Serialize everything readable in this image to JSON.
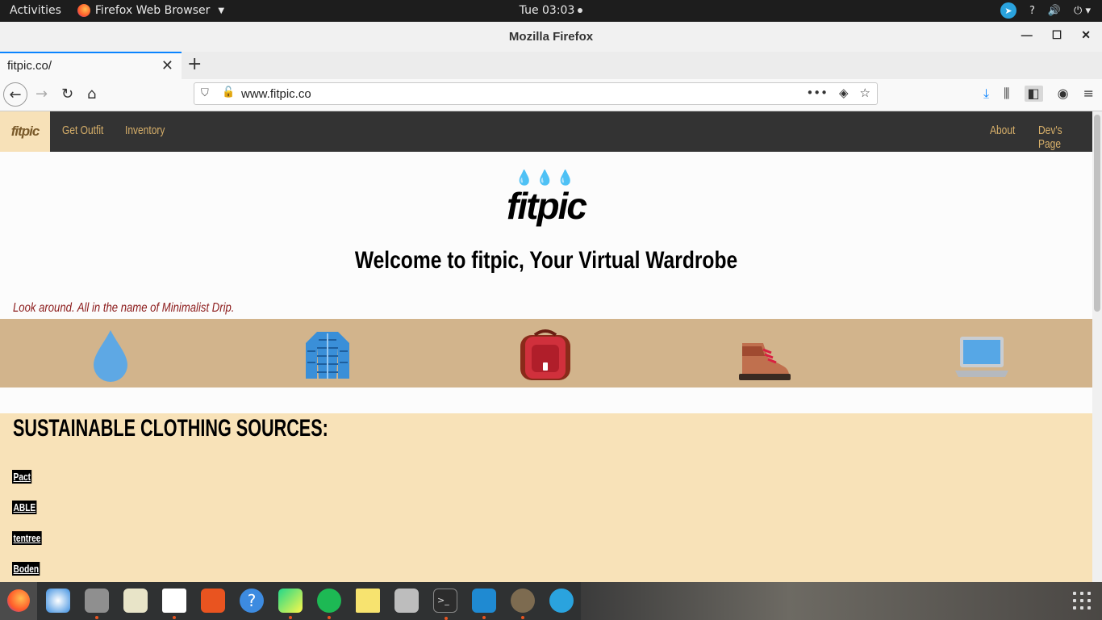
{
  "system": {
    "activities": "Activities",
    "app_name": "Firefox Web Browser",
    "clock": "Tue 03:03"
  },
  "window": {
    "title": "Mozilla Firefox"
  },
  "browser": {
    "tab_title": "fitpic.co/",
    "url": "www.fitpic.co"
  },
  "site": {
    "brand": "fitpic",
    "nav_left": [
      "Get Outfit",
      "Inventory"
    ],
    "nav_right": [
      "About",
      "Dev's Page"
    ],
    "logo_text": "fitpic",
    "welcome": "Welcome to fitpic, Your Virtual Wardrobe",
    "tagline": "Look around. All in the name of Minimalist Drip.",
    "strip_icons": [
      "droplet-icon",
      "jacket-icon",
      "backpack-icon",
      "boot-icon",
      "laptop-icon"
    ],
    "sources_heading": "SUSTAINABLE CLOTHING SOURCES:",
    "sources": [
      "Pact",
      "ABLE",
      "tentree",
      "Boden"
    ]
  },
  "colors": {
    "navbar": "#333333",
    "brand_bg": "#f7e1b8",
    "nav_text": "#d8b06a",
    "strip_bg": "#d2b48c",
    "sources_bg": "#f8e2b8",
    "tagline": "#8b1a1a"
  }
}
